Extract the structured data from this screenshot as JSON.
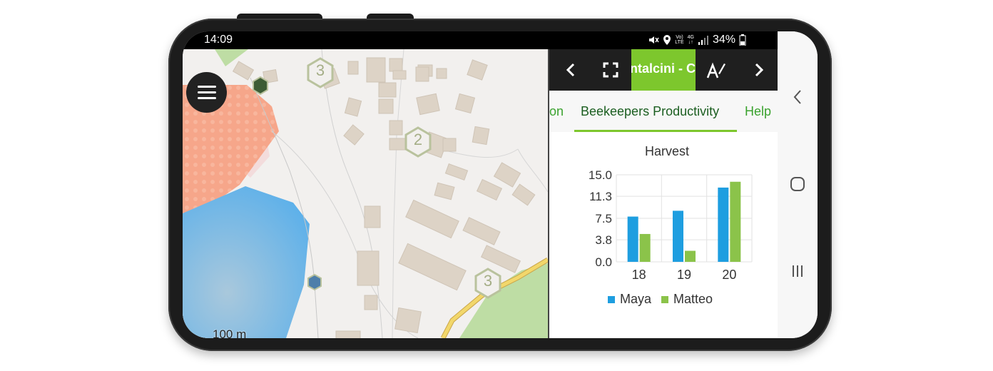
{
  "status": {
    "time": "14:09",
    "network": "4G",
    "volte_top": "Vo)",
    "volte_bottom": "LTE",
    "battery": "34%",
    "icons": [
      "mute-icon",
      "location-icon",
      "volte-icon",
      "4g-icon",
      "signal-icon",
      "battery-icon"
    ]
  },
  "map": {
    "scale_label": "100 m",
    "cluster_labels": [
      "3",
      "2",
      "3"
    ],
    "colors": {
      "water": "#6cb4e4",
      "orchard": "#f6a68a",
      "park": "#bedda4",
      "road": "#f2d76b",
      "building": "#ddd3c6"
    }
  },
  "panel": {
    "title": "ontalcini - C",
    "tabs": [
      "ion",
      "Beekeepers Productivity",
      "Help"
    ],
    "active_tab": "Beekeepers Productivity",
    "colors": {
      "accent": "#7dc72d",
      "active_tab_text": "#1b5e20",
      "tab_text": "#3aa22e"
    }
  },
  "chart_data": {
    "type": "bar",
    "title": "Harvest",
    "categories": [
      "18",
      "19",
      "20"
    ],
    "yticks": [
      "15.0",
      "11.3",
      "7.5",
      "3.8",
      "0.0"
    ],
    "ylim": [
      0,
      15
    ],
    "grid": true,
    "legend_position": "bottom",
    "series": [
      {
        "name": "Maya",
        "color": "#1e9ee0",
        "values": [
          7.8,
          8.8,
          12.8
        ]
      },
      {
        "name": "Matteo",
        "color": "#8bc34a",
        "values": [
          4.8,
          1.9,
          13.8
        ]
      }
    ]
  },
  "navbar": {
    "icons": [
      "back-icon",
      "home-icon",
      "recents-icon"
    ]
  }
}
